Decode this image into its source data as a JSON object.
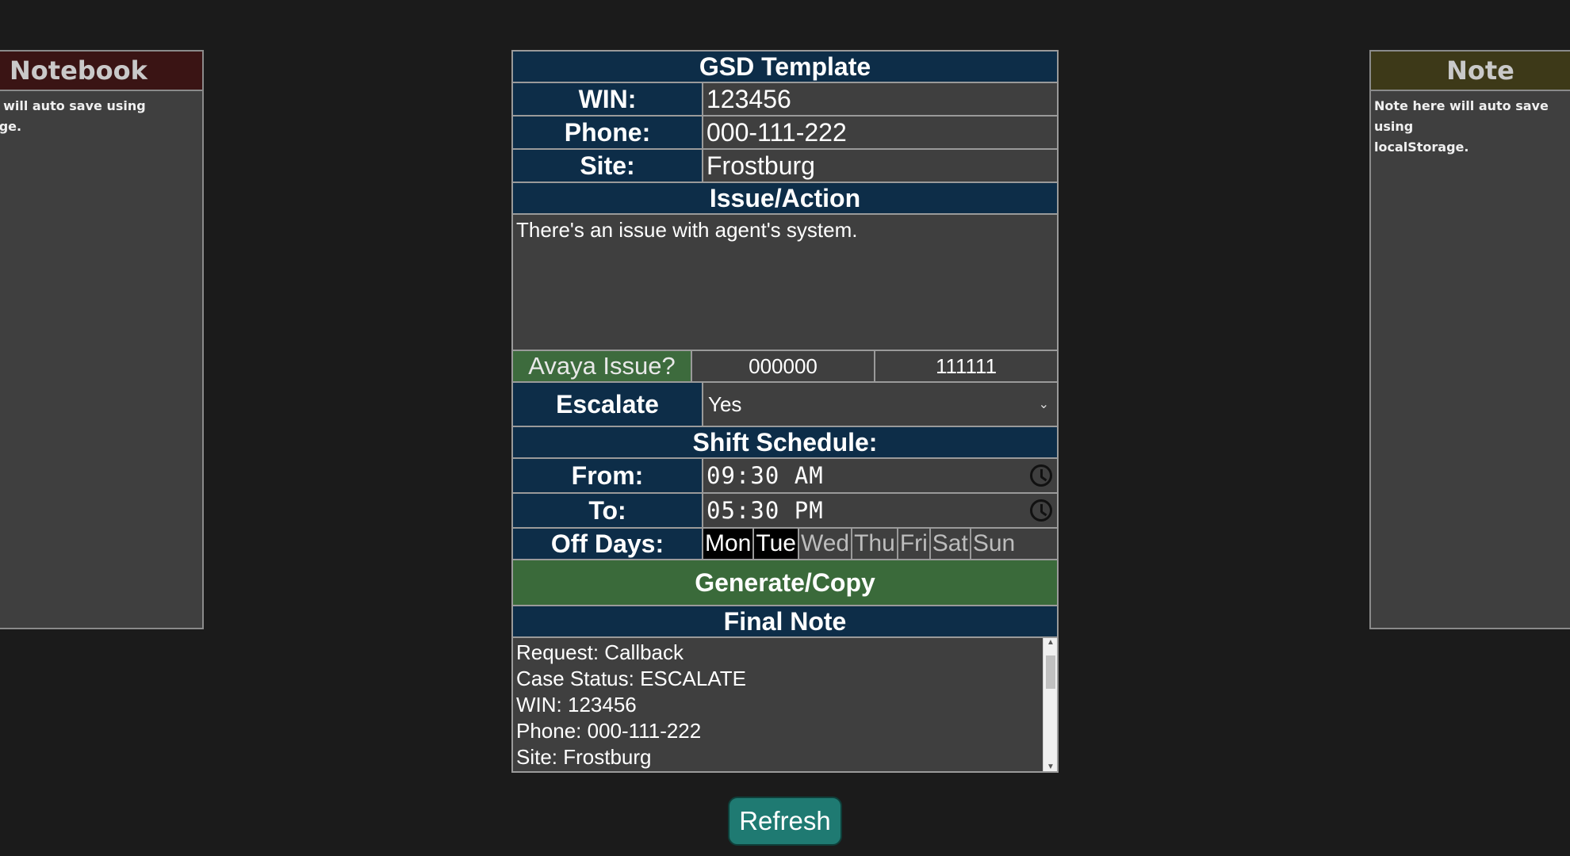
{
  "left_panel": {
    "title": "Notebook",
    "text": "te will auto save using\nrage."
  },
  "right_panel": {
    "title": "Note",
    "text": "Note here will auto save using\nlocalStorage."
  },
  "template": {
    "title": "GSD Template",
    "win_label": "WIN:",
    "win_value": "123456",
    "phone_label": "Phone:",
    "phone_value": "000-111-222",
    "site_label": "Site:",
    "site_value": "Frostburg",
    "issue_header": "Issue/Action",
    "issue_text": "There's an issue with agent's system.",
    "avaya_label": "Avaya Issue?",
    "avaya_value_1": "000000",
    "avaya_value_2": "111111",
    "escalate_label": "Escalate",
    "escalate_value": "Yes",
    "shift_header": "Shift Schedule:",
    "from_label": "From:",
    "from_value": "09:30 AM",
    "to_label": "To:",
    "to_value": "05:30 PM",
    "offdays_label": "Off Days:",
    "days": [
      "Mon",
      "Tue",
      "Wed",
      "Thu",
      "Fri",
      "Sat",
      "Sun"
    ],
    "selected_days": [
      "Mon",
      "Tue"
    ],
    "generate_label": "Generate/Copy",
    "final_header": "Final Note",
    "final_lines": [
      "Request: Callback",
      "Case Status: ESCALATE",
      "WIN: 123456",
      "Phone: 000-111-222",
      "Site: Frostburg"
    ]
  },
  "refresh_label": "Refresh",
  "colors": {
    "background": "#1b1b1b",
    "header_blue": "#0d2d48",
    "accent_green": "#3a6a3a",
    "refresh_teal": "#1f7a72"
  }
}
